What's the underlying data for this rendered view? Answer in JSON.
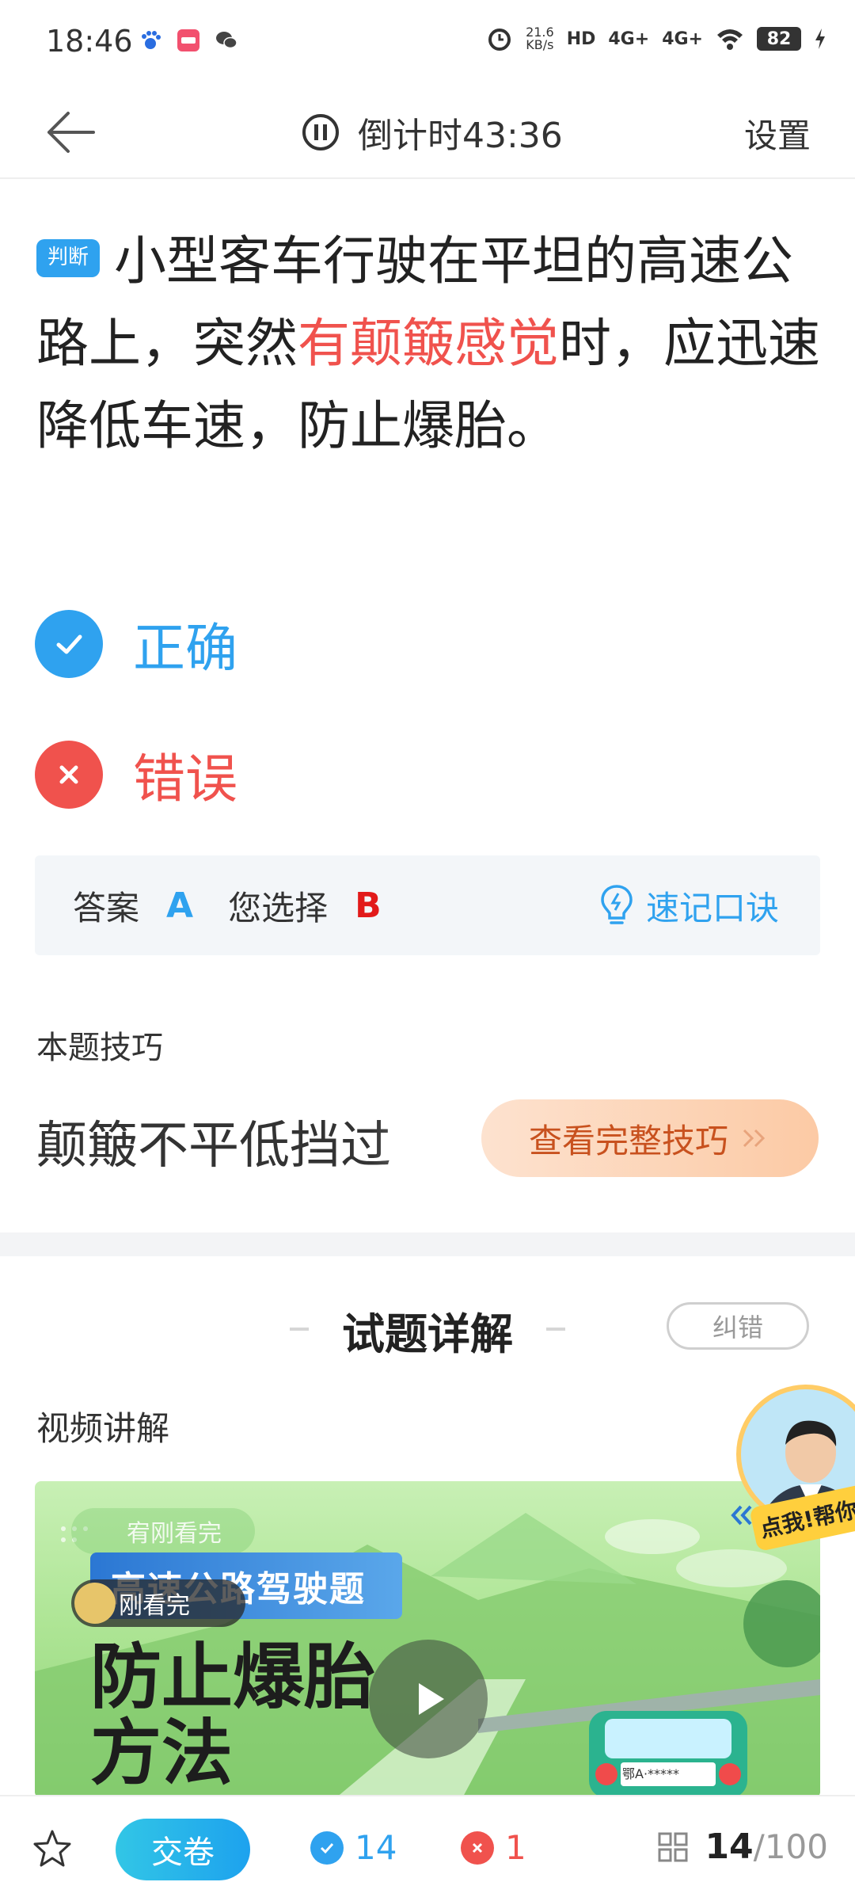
{
  "status_bar": {
    "time": "18:46",
    "net_speed_value": "21.6",
    "net_speed_unit": "KB/s",
    "hd": "HD",
    "network_1": "4G+",
    "network_2": "4G+",
    "battery": "82"
  },
  "header": {
    "timer_label": "倒计时43:36",
    "settings_label": "设置"
  },
  "question": {
    "type_tag": "判断",
    "text_before": "小型客车行驶在平坦的高速公路上，突然",
    "text_highlight": "有颠簸感觉",
    "text_after": "时，应迅速降低车速，防止爆胎。",
    "highlight_color": "#f0524d"
  },
  "options": [
    {
      "label": "正确",
      "state": "correct",
      "color": "#2fa2ef"
    },
    {
      "label": "错误",
      "state": "wrong",
      "color": "#f0524d"
    }
  ],
  "answer": {
    "answer_label": "答案",
    "answer_value": "A",
    "selected_label": "您选择",
    "selected_value": "B",
    "quick_memo": "速记口诀"
  },
  "tip": {
    "title": "本题技巧",
    "text": "颠簸不平低挡过",
    "button": "查看完整技巧"
  },
  "detail": {
    "title": "试题详解",
    "report": "纠错",
    "video_label": "视频讲解"
  },
  "video": {
    "viewer_chip_1": "宥刚看完",
    "viewer_chip_2": "刚看完",
    "tag": "高速公路驾驶题",
    "title_line1": "防止爆胎",
    "title_line2": "方法",
    "plate": "鄂A·*****"
  },
  "helper": {
    "text": "点我!帮你讲"
  },
  "bottom_bar": {
    "submit": "交卷",
    "correct_count": "14",
    "wrong_count": "1",
    "current": "14",
    "total": "/100"
  }
}
